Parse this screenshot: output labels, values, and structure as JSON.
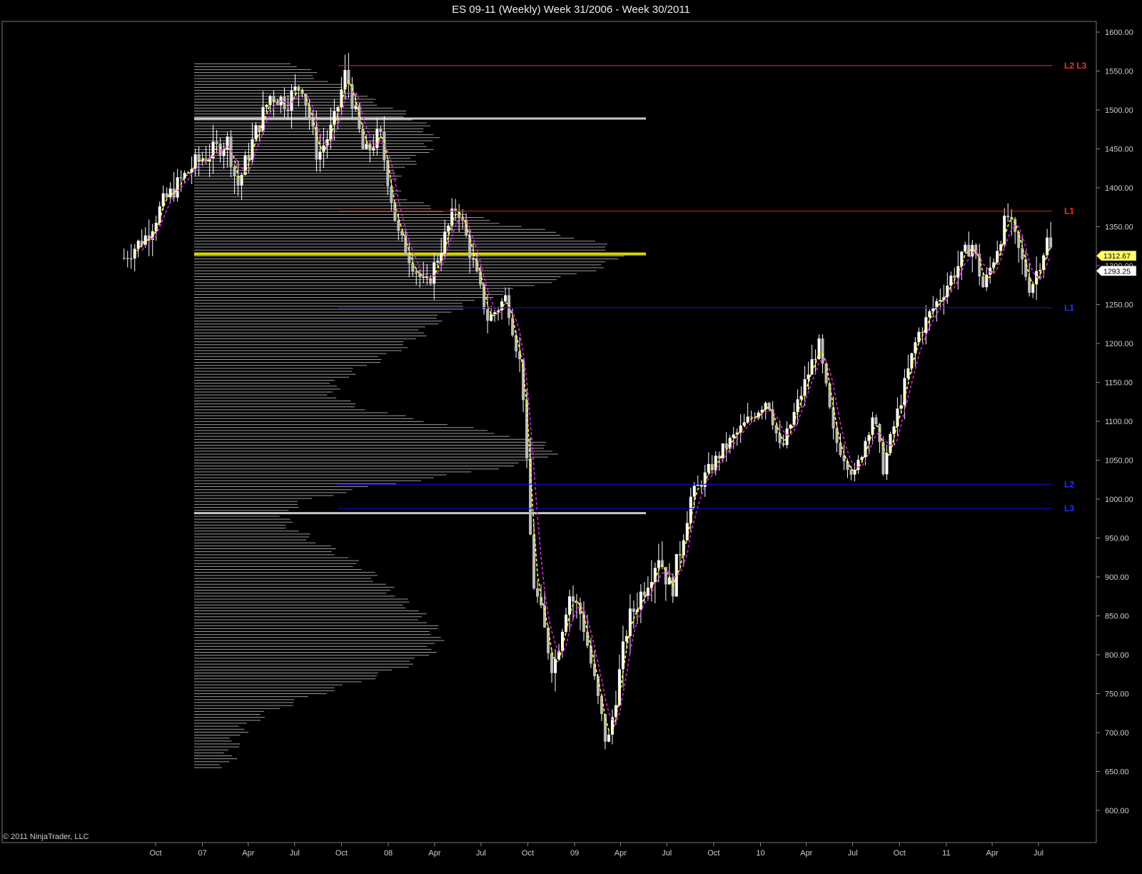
{
  "window": {
    "title": "ES 09-11 (Weekly)  Week 31/2006 - Week 30/2011"
  },
  "footer": {
    "copyright": "© 2011 NinjaTrader, LLC"
  },
  "chart_data": {
    "type": "candlestick",
    "title": "ES 09-11 (Weekly)  Week 31/2006 - Week 30/2011",
    "xlabel": "",
    "ylabel": "",
    "ylim": [
      575,
      1625
    ],
    "grid": false,
    "y_ticks": [
      1600,
      1550,
      1500,
      1450,
      1400,
      1350,
      1300,
      1250,
      1200,
      1150,
      1100,
      1050,
      1000,
      950,
      900,
      850,
      800,
      750,
      700,
      650,
      600
    ],
    "x_ticks": [
      {
        "label": "Oct",
        "date": "2006-10-01"
      },
      {
        "label": "07",
        "date": "2007-01-01"
      },
      {
        "label": "Apr",
        "date": "2007-04-01"
      },
      {
        "label": "Jul",
        "date": "2007-07-01"
      },
      {
        "label": "Oct",
        "date": "2007-10-01"
      },
      {
        "label": "08",
        "date": "2008-01-01"
      },
      {
        "label": "Apr",
        "date": "2008-04-01"
      },
      {
        "label": "Jul",
        "date": "2008-07-01"
      },
      {
        "label": "Oct",
        "date": "2008-10-01"
      },
      {
        "label": "09",
        "date": "2009-01-01"
      },
      {
        "label": "Apr",
        "date": "2009-04-01"
      },
      {
        "label": "Jul",
        "date": "2009-07-01"
      },
      {
        "label": "Oct",
        "date": "2009-10-01"
      },
      {
        "label": "10",
        "date": "2010-01-01"
      },
      {
        "label": "Apr",
        "date": "2010-04-01"
      },
      {
        "label": "Jul",
        "date": "2010-07-01"
      },
      {
        "label": "Oct",
        "date": "2010-10-01"
      },
      {
        "label": "11",
        "date": "2011-01-01"
      },
      {
        "label": "Apr",
        "date": "2011-04-01"
      },
      {
        "label": "Jul",
        "date": "2011-07-01"
      }
    ],
    "price_path": [
      {
        "date": "2006-07-31",
        "close": 1310
      },
      {
        "date": "2006-09-15",
        "close": 1340
      },
      {
        "date": "2006-10-15",
        "close": 1380
      },
      {
        "date": "2006-12-15",
        "close": 1430
      },
      {
        "date": "2007-02-20",
        "close": 1460
      },
      {
        "date": "2007-03-10",
        "close": 1400
      },
      {
        "date": "2007-04-15",
        "close": 1470
      },
      {
        "date": "2007-05-15",
        "close": 1520
      },
      {
        "date": "2007-06-15",
        "close": 1510
      },
      {
        "date": "2007-07-15",
        "close": 1535
      },
      {
        "date": "2007-08-15",
        "close": 1440
      },
      {
        "date": "2007-09-15",
        "close": 1480
      },
      {
        "date": "2007-10-10",
        "close": 1550
      },
      {
        "date": "2007-11-15",
        "close": 1440
      },
      {
        "date": "2007-12-15",
        "close": 1470
      },
      {
        "date": "2008-01-20",
        "close": 1340
      },
      {
        "date": "2008-03-15",
        "close": 1270
      },
      {
        "date": "2008-05-15",
        "close": 1380
      },
      {
        "date": "2008-07-15",
        "close": 1230
      },
      {
        "date": "2008-08-20",
        "close": 1260
      },
      {
        "date": "2008-09-20",
        "close": 1160
      },
      {
        "date": "2008-10-10",
        "close": 900
      },
      {
        "date": "2008-11-20",
        "close": 780
      },
      {
        "date": "2008-12-20",
        "close": 880
      },
      {
        "date": "2009-01-15",
        "close": 850
      },
      {
        "date": "2009-03-06",
        "close": 680
      },
      {
        "date": "2009-04-15",
        "close": 840
      },
      {
        "date": "2009-06-15",
        "close": 930
      },
      {
        "date": "2009-07-10",
        "close": 880
      },
      {
        "date": "2009-08-15",
        "close": 1000
      },
      {
        "date": "2009-10-15",
        "close": 1060
      },
      {
        "date": "2010-01-15",
        "close": 1130
      },
      {
        "date": "2010-02-10",
        "close": 1060
      },
      {
        "date": "2010-04-25",
        "close": 1200
      },
      {
        "date": "2010-05-25",
        "close": 1080
      },
      {
        "date": "2010-07-05",
        "close": 1030
      },
      {
        "date": "2010-08-10",
        "close": 1110
      },
      {
        "date": "2010-08-30",
        "close": 1040
      },
      {
        "date": "2010-11-05",
        "close": 1210
      },
      {
        "date": "2011-01-15",
        "close": 1290
      },
      {
        "date": "2011-02-20",
        "close": 1330
      },
      {
        "date": "2011-03-15",
        "close": 1270
      },
      {
        "date": "2011-05-01",
        "close": 1365
      },
      {
        "date": "2011-06-15",
        "close": 1270
      },
      {
        "date": "2011-07-22",
        "close": 1340
      },
      {
        "date": "2011-07-29",
        "close": 1293
      }
    ],
    "horizontal_levels": [
      {
        "label": "L2 L3",
        "value": 1557,
        "color": "#cc2222"
      },
      {
        "label": "L1",
        "value": 1370,
        "color": "#cc2222"
      },
      {
        "label": "L1",
        "value": 1246,
        "color": "#1111cc"
      },
      {
        "label": "L2",
        "value": 1019,
        "color": "#1111cc"
      },
      {
        "label": "L3",
        "value": 988,
        "color": "#1111cc"
      }
    ],
    "volume_profile_lines": [
      {
        "value": 1489,
        "color": "#c8c8c8"
      },
      {
        "value": 1315,
        "color": "#d8d800"
      },
      {
        "value": 982,
        "color": "#c8c8c8"
      }
    ],
    "price_markers": [
      {
        "label": "1312.67",
        "value": 1312.67,
        "color": "#ffff66"
      },
      {
        "label": "1293.25",
        "value": 1293.25,
        "color": "#ffffff"
      }
    ],
    "indicators": [
      {
        "style": "dashed",
        "color": "#ffff33"
      },
      {
        "style": "dashed",
        "color": "#dd22dd"
      }
    ],
    "colors": {
      "background": "#000000",
      "candles": "#ffffff",
      "volume_profile": "#9a9a9a"
    }
  }
}
